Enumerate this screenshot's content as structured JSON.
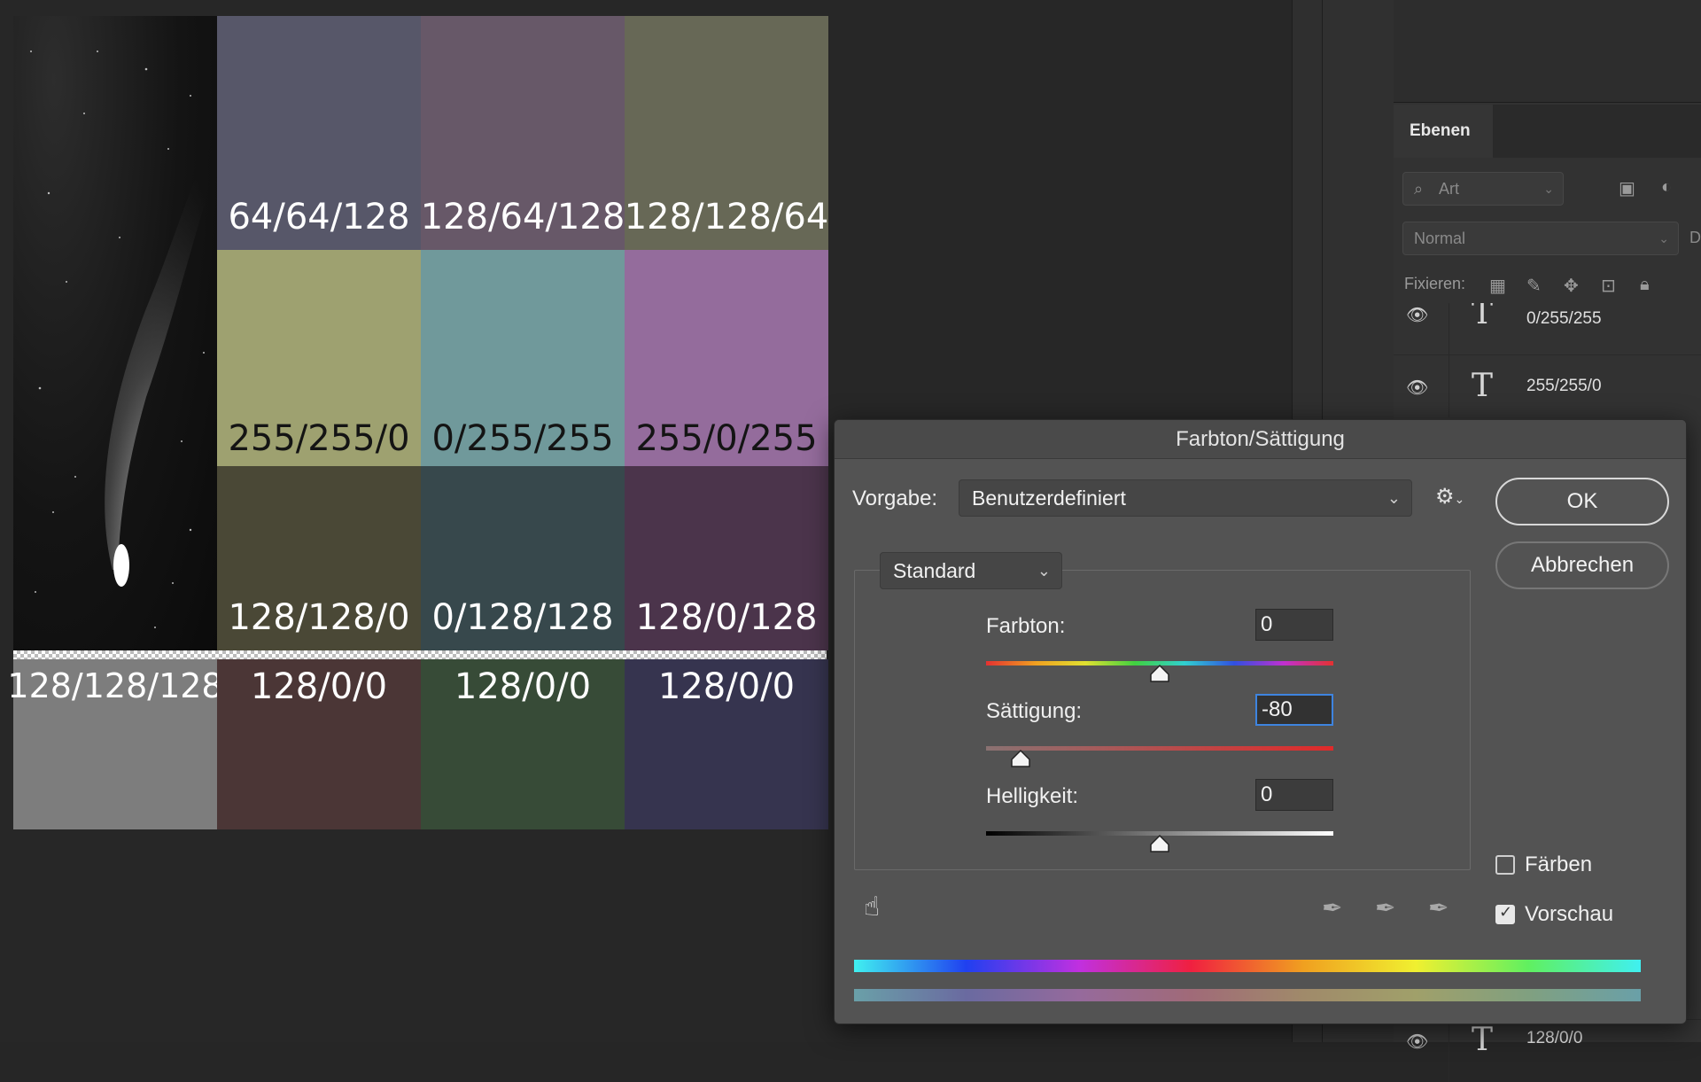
{
  "canvas": {
    "tiles": [
      {
        "row": 0,
        "col": 1,
        "label": "64/64/128",
        "color": "#575769"
      },
      {
        "row": 0,
        "col": 2,
        "label": "128/64/128",
        "color": "#675868"
      },
      {
        "row": 0,
        "col": 3,
        "label": "128/128/64",
        "color": "#676856"
      },
      {
        "row": 1,
        "col": 1,
        "label": "255/255/0",
        "color": "#9ea170",
        "dark": true
      },
      {
        "row": 1,
        "col": 2,
        "label": "0/255/255",
        "color": "#70999b",
        "dark": true
      },
      {
        "row": 1,
        "col": 3,
        "label": "255/0/255",
        "color": "#946c9c",
        "dark": true
      },
      {
        "row": 2,
        "col": 1,
        "label": "128/128/0",
        "color": "#4a4836"
      },
      {
        "row": 2,
        "col": 2,
        "label": "0/128/128",
        "color": "#37484c"
      },
      {
        "row": 2,
        "col": 3,
        "label": "128/0/128",
        "color": "#4b344b"
      },
      {
        "row": 3,
        "col": 0,
        "label": "128/128/128",
        "color": "#7d7d7d"
      },
      {
        "row": 3,
        "col": 1,
        "label": "128/0/0",
        "color": "#4b3636"
      },
      {
        "row": 3,
        "col": 2,
        "label": "128/0/0",
        "color": "#374b37"
      },
      {
        "row": 3,
        "col": 3,
        "label": "128/0/0",
        "color": "#36344f"
      }
    ]
  },
  "layers_panel": {
    "tab_label": "Ebenen",
    "filter_placeholder": "Art",
    "blend_mode": "Normal",
    "opacity_label_partial": "D",
    "lock_label": "Fixieren:",
    "layers": [
      {
        "name": "0/255/255",
        "icon": "text-layer-icon"
      },
      {
        "name": "255/255/0",
        "icon": "text-layer-icon"
      },
      {
        "name": "128/0/0",
        "icon": "text-layer-icon"
      }
    ]
  },
  "dialog": {
    "title": "Farbton/Sättigung",
    "preset_label": "Vorgabe:",
    "preset_value": "Benutzerdefiniert",
    "channel_value": "Standard",
    "ok_label": "OK",
    "cancel_label": "Abbrechen",
    "hue": {
      "label": "Farbton:",
      "value": "0",
      "range": [
        -180,
        180
      ],
      "num": 0
    },
    "saturation": {
      "label": "Sättigung:",
      "value": "-80",
      "range": [
        -100,
        100
      ],
      "num": -80
    },
    "lightness": {
      "label": "Helligkeit:",
      "value": "0",
      "range": [
        -100,
        100
      ],
      "num": 0
    },
    "colorize_label": "Färben",
    "colorize_checked": false,
    "preview_label": "Vorschau",
    "preview_checked": true
  }
}
